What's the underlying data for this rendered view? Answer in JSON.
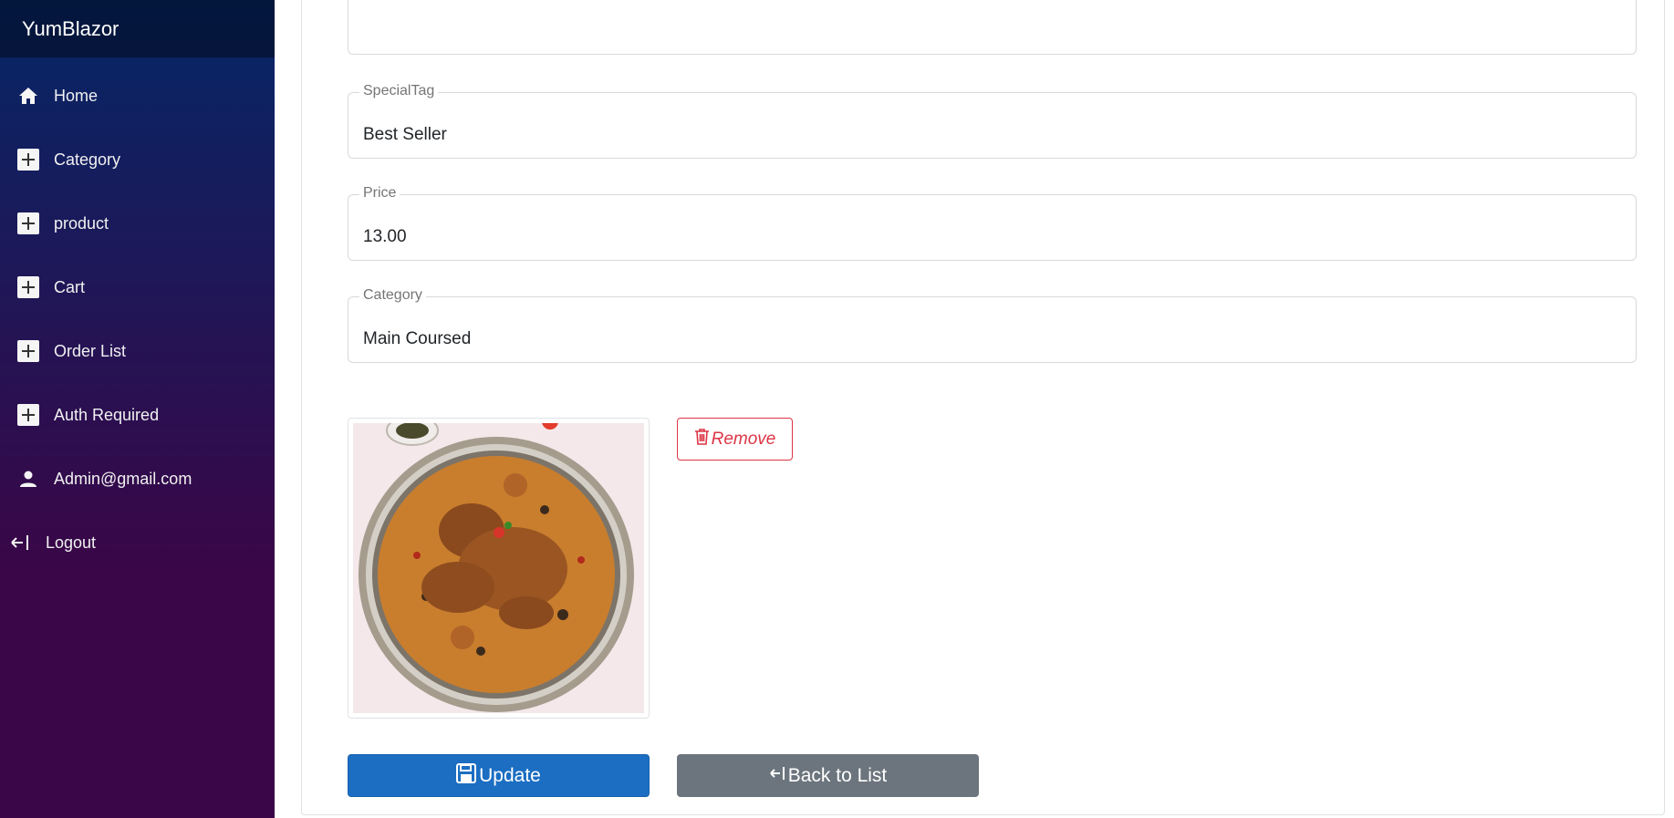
{
  "app": {
    "brand": "YumBlazor"
  },
  "sidebar": {
    "items": [
      {
        "label": "Home",
        "icon": "home-icon"
      },
      {
        "label": "Category",
        "icon": "plus-square-icon"
      },
      {
        "label": "product",
        "icon": "plus-square-icon"
      },
      {
        "label": "Cart",
        "icon": "plus-square-icon"
      },
      {
        "label": "Order List",
        "icon": "plus-square-icon"
      },
      {
        "label": "Auth Required",
        "icon": "plus-square-icon"
      },
      {
        "label": "Admin@gmail.com",
        "icon": "person-icon"
      },
      {
        "label": "Logout",
        "icon": "logout-arrow-icon"
      }
    ]
  },
  "form": {
    "special_tag": {
      "label": "SpecialTag",
      "value": "Best Seller"
    },
    "price": {
      "label": "Price",
      "value": "13.00"
    },
    "category": {
      "label": "Category",
      "value": "Main Coursed"
    }
  },
  "image": {
    "alt": "product-image"
  },
  "actions": {
    "remove_label": "Remove",
    "update_label": "Update",
    "back_label": "Back to List"
  },
  "colors": {
    "sidebar_top": "#052767",
    "sidebar_bottom": "#3a0647",
    "primary": "#1b6ec2",
    "danger": "#dc3545",
    "secondary": "#6c757d"
  }
}
